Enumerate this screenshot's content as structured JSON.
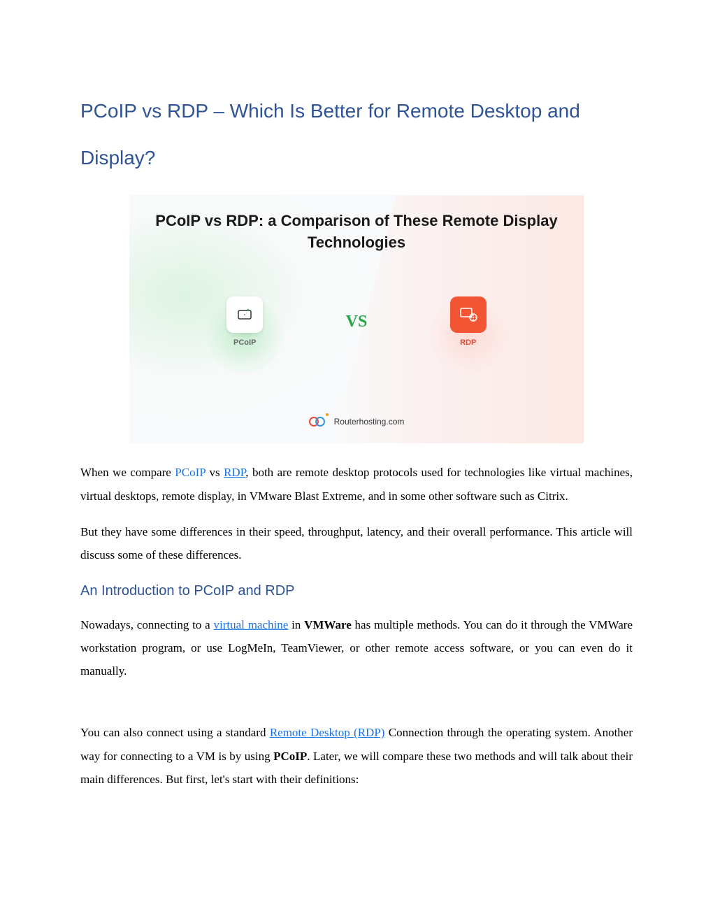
{
  "title": "PCoIP vs RDP – Which Is Better for Remote Desktop and Display?",
  "figure": {
    "heading": "PCoIP vs RDP: a Comparison of These Remote Display Technologies",
    "pcoip_label": "PCoIP",
    "vs_text": "VS",
    "rdp_label": "RDP",
    "footer": "Routerhosting.com"
  },
  "para1": {
    "pre": "When we compare ",
    "link1": "PCoIP",
    "mid1": " vs ",
    "link2": "RDP",
    "rest": ", both are remote desktop protocols used for technologies like virtual machines, virtual desktops, remote display, in VMware Blast Extreme, and in some other software such as Citrix."
  },
  "para2": "But they have some differences in their speed, throughput, latency, and their overall performance. This article will discuss some of these differences.",
  "heading2": "An Introduction to PCoIP and RDP",
  "para3": {
    "pre": "Nowadays, connecting to a ",
    "link": "virtual machine",
    "mid": " in ",
    "bold": "VMWare",
    "rest": " has multiple methods. You can do it through the VMWare workstation program, or use LogMeIn, TeamViewer, or other remote access software, or you can even do it manually."
  },
  "para4": {
    "pre": "You can also connect using a standard ",
    "link": "Remote Desktop (RDP)",
    "mid": " Connection through the operating system. Another way for connecting to a VM is by using ",
    "bold": "PCoIP",
    "rest": ". Later, we will compare these two methods and will talk about their main differences. But first, let's start with their definitions:"
  }
}
